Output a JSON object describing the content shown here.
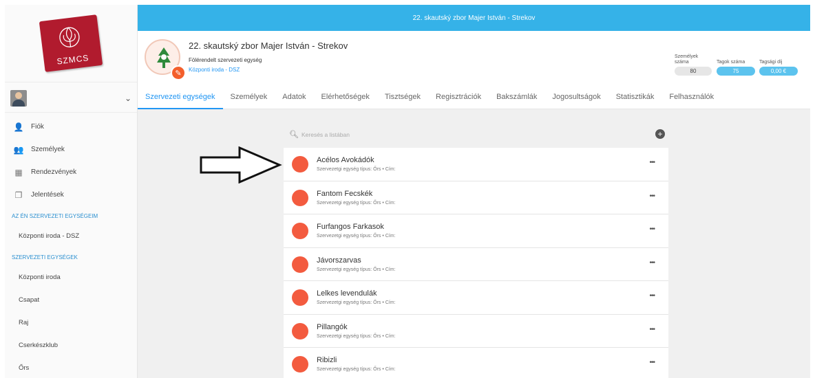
{
  "app": {
    "title": "22. skautský zbor Majer István - Strekov"
  },
  "logo": {
    "text": "SZMCS"
  },
  "icons": [
    "chevron-down-icon",
    "user-icon",
    "people-icon",
    "calendar-icon",
    "reports-icon",
    "search-icon",
    "plus-circle-icon",
    "more-icon",
    "pencil-icon"
  ],
  "sidebar": {
    "nav": [
      {
        "label": "Fiók",
        "icon": "user-icon",
        "glyph": "👤"
      },
      {
        "label": "Személyek",
        "icon": "people-icon",
        "glyph": "👥"
      },
      {
        "label": "Rendezvények",
        "icon": "calendar-icon",
        "glyph": "▦"
      },
      {
        "label": "Jelentések",
        "icon": "reports-icon",
        "glyph": "❐"
      }
    ],
    "my_units_title": "AZ ÉN SZERVEZETI EGYSÉGEIM",
    "my_units": [
      "Központi iroda - DSZ"
    ],
    "units_title": "SZERVEZETI EGYSÉGEK",
    "units": [
      "Központi iroda",
      "Csapat",
      "Raj",
      "Cserkészklub",
      "Őrs"
    ]
  },
  "header": {
    "name": "22. skautský zbor Majer István - Strekov",
    "parent_label": "Fölérendelt szervezeti egység",
    "parent_link": "Központi iroda - DSZ",
    "stats": {
      "persons_label_1": "Személyek",
      "persons_label_2": "száma",
      "persons_value": "80",
      "members_label": "Tagok száma",
      "members_value": "75",
      "fee_label": "Tagsági díj",
      "fee_value": "0,00 €"
    }
  },
  "tabs": [
    "Szervezeti egységek",
    "Személyek",
    "Adatok",
    "Elérhetőségek",
    "Tisztségek",
    "Regisztrációk",
    "Bakszámlák",
    "Jogosultságok",
    "Statisztikák",
    "Felhasználók"
  ],
  "search": {
    "placeholder": "Keresés a listában"
  },
  "units_list": [
    {
      "name": "Acélos Avokádók",
      "meta": "Szervezetgi egység típus: Őrs • Cím:"
    },
    {
      "name": "Fantom Fecskék",
      "meta": "Szervezetgi egység típus: Őrs • Cím:"
    },
    {
      "name": "Furfangos Farkasok",
      "meta": "Szervezetgi egység típus: Őrs • Cím:"
    },
    {
      "name": "Jávorszarvas",
      "meta": "Szervezetgi egység típus: Őrs • Cím:"
    },
    {
      "name": "Lelkes levendulák",
      "meta": "Szervezetgi egység típus: Őrs • Cím:"
    },
    {
      "name": "Pillangók",
      "meta": "Szervezetgi egység típus: Őrs • Cím:"
    },
    {
      "name": "Ribizli",
      "meta": "Szervezetgi egység típus: Őrs • Cím:"
    }
  ],
  "colors": {
    "accent": "#35b2e8",
    "link": "#2196f3",
    "unit_dot": "#f35b3f",
    "logo_red": "#b11b2e"
  }
}
